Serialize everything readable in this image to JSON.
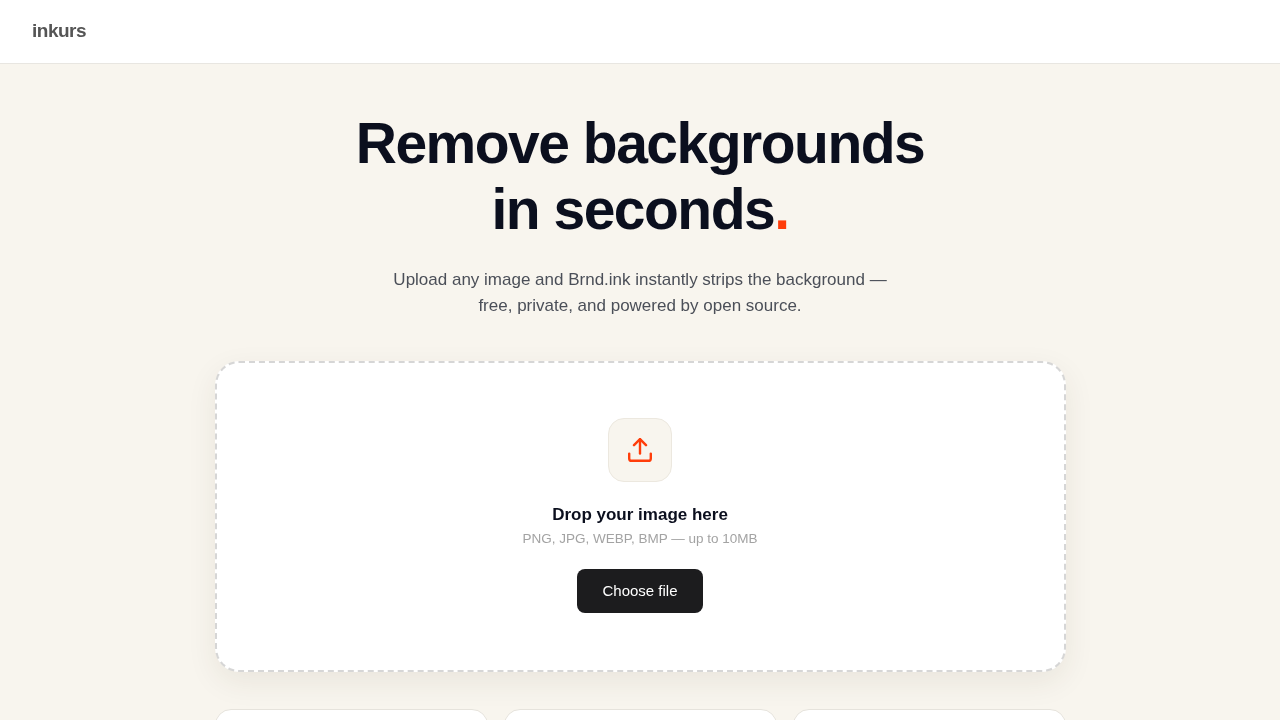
{
  "header": {
    "logo": "inkurs"
  },
  "hero": {
    "title_lines": [
      "Remove backgrounds",
      "in seconds"
    ],
    "title_accent": ".",
    "description_lines": [
      "Upload any image and Brnd.ink instantly strips the background —",
      "free, private, and powered by open source."
    ]
  },
  "dropzone": {
    "title": "Drop your image here",
    "hint": "PNG, JPG, WEBP, BMP — up to 10MB",
    "button": "Choose file"
  },
  "cards": [
    {
      "kind": "card"
    },
    {
      "kind": "card"
    },
    {
      "kind": "card"
    }
  ]
}
